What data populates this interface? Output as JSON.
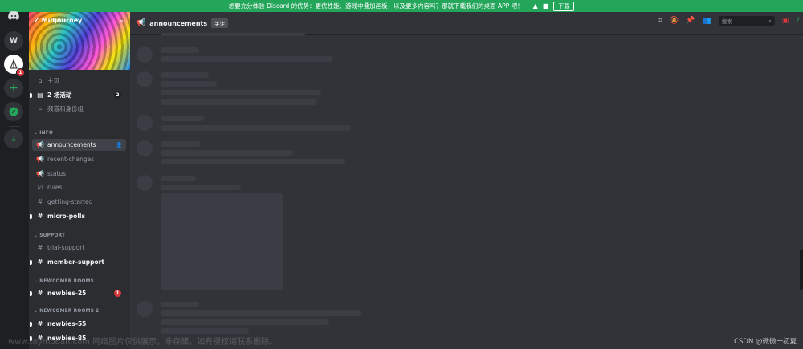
{
  "banner": {
    "text": "想要充分体验 Discord 的优势：更优性能、游戏中叠加画板，以及更多内容吗？那就下载我们的桌面 APP 吧！",
    "download_label": "下载"
  },
  "guilds": {
    "w_label": "W",
    "mj_badge": "1"
  },
  "server": {
    "name": "Midjourney",
    "home": "主页",
    "events": "2 场活动",
    "events_badge": "2",
    "channels_roles": "频道和身份组"
  },
  "categories": {
    "info": "INFO",
    "support": "SUPPORT",
    "newcomer": "NEWCOMER ROOMS",
    "newcomer2": "NEWCOMER ROOMS 2"
  },
  "channels": {
    "announcements": "announcements",
    "recent_changes": "recent-changes",
    "status": "status",
    "rules": "rules",
    "getting_started": "getting-started",
    "micro_polls": "micro-polls",
    "trial_support": "trial-support",
    "member_support": "member-support",
    "newbies_25": "newbies-25",
    "newbies_25_badge": "1",
    "newbies_55": "newbies-55",
    "newbies_85": "newbies-85"
  },
  "header": {
    "channel": "announcements",
    "follow": "关注",
    "search_placeholder": "搜索"
  },
  "watermark": {
    "csdn": "CSDN @微微一初夏",
    "faint": "www.toymoban.com 网络图片仅供展示，非存储，如有侵权请联系删除。"
  },
  "colors": {
    "banner": "#23a55a",
    "accent_green": "#23a55a",
    "badge_red": "#da373c"
  }
}
